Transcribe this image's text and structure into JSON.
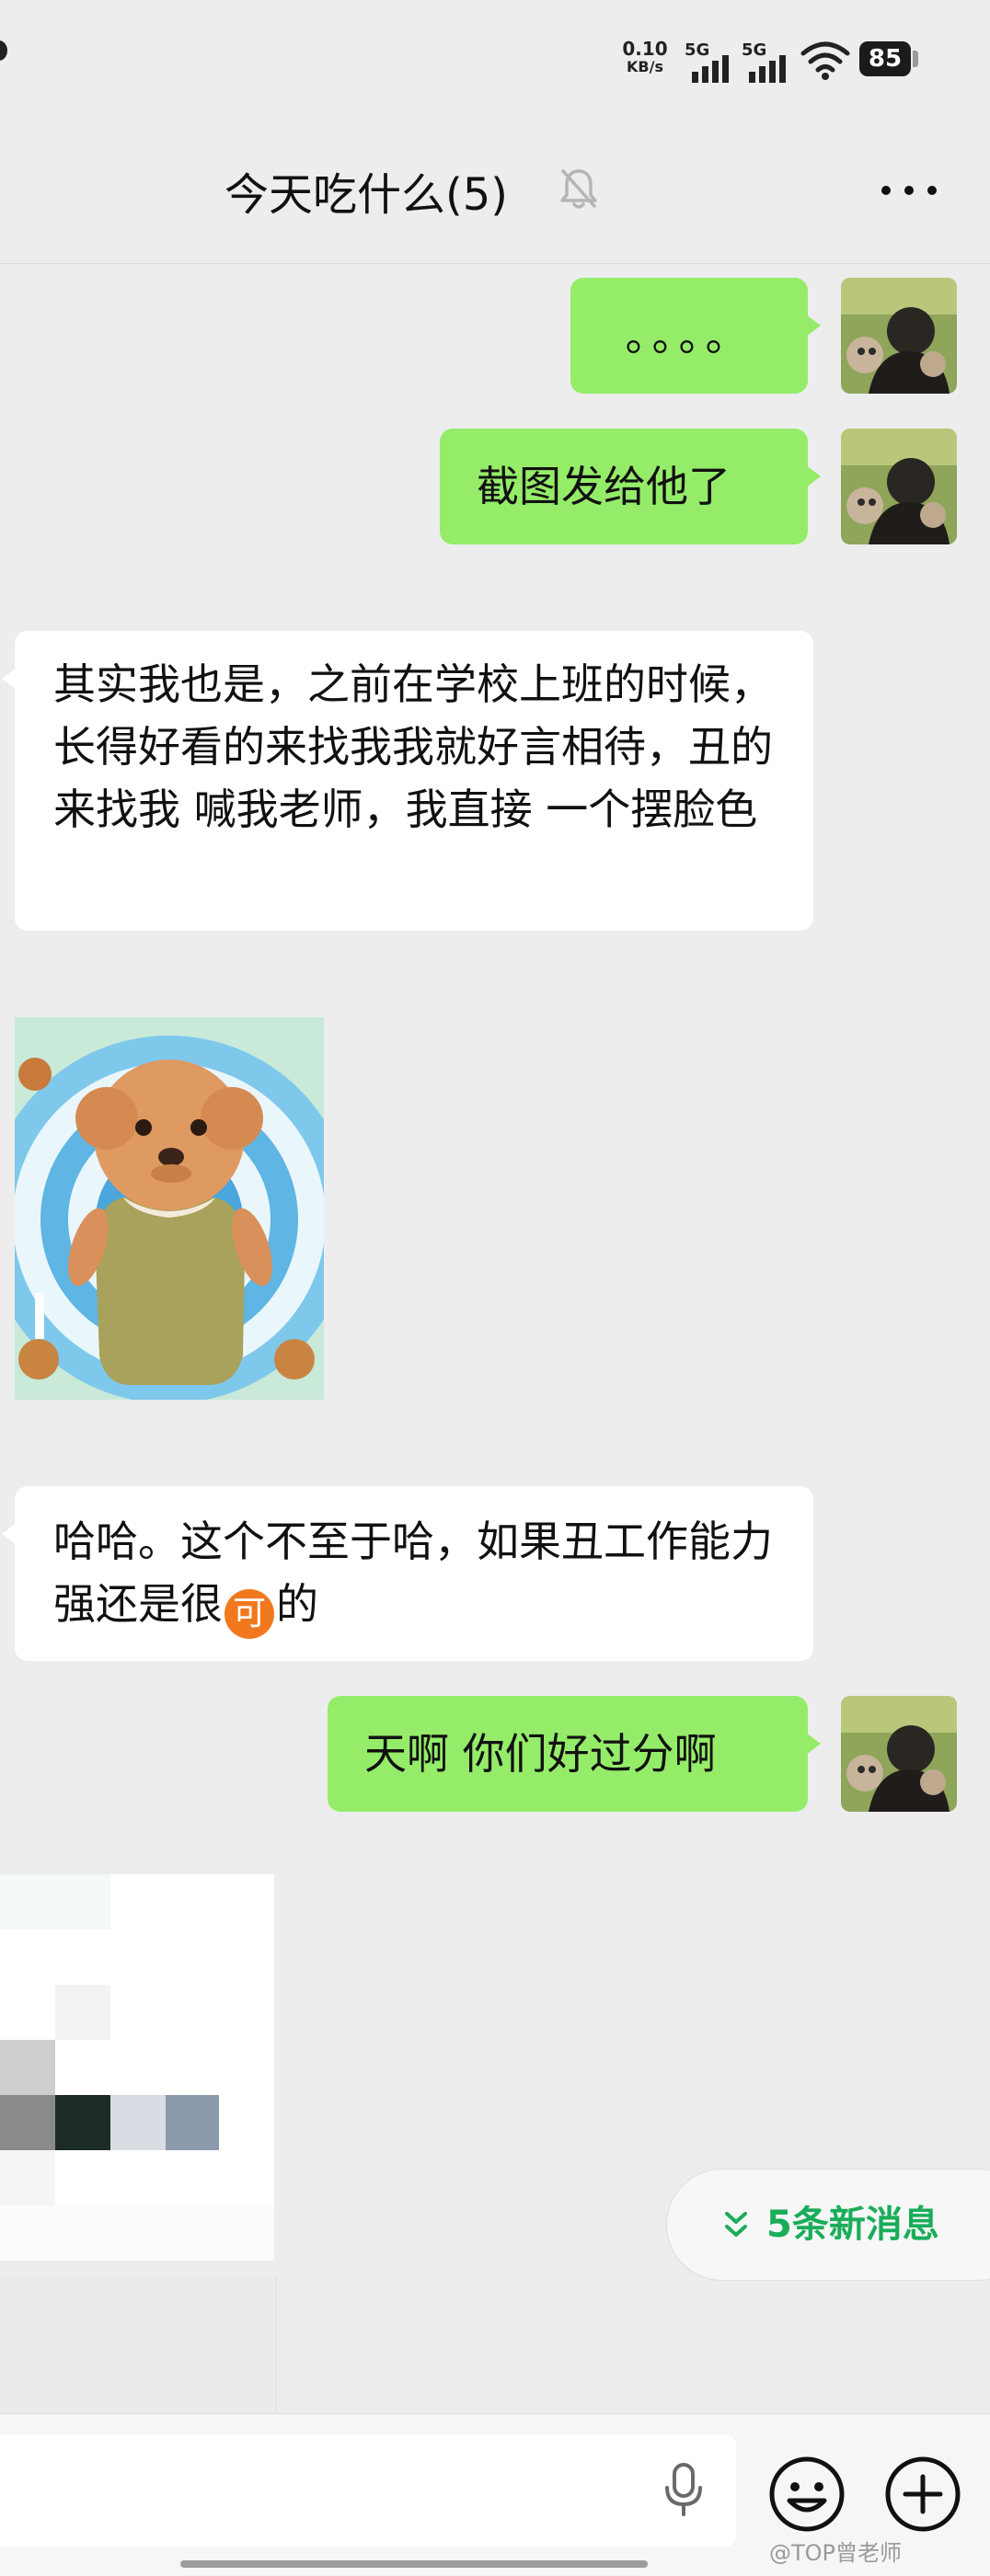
{
  "status_bar": {
    "net_speed_value": "0.10",
    "net_speed_unit": "KB/s",
    "signal_1_label": "5G",
    "signal_2_label": "5G",
    "battery_level": "85"
  },
  "header": {
    "title": "今天吃什么(5)",
    "muted_icon": "bell-off-icon",
    "more_icon": "more-dots-icon"
  },
  "messages": [
    {
      "side": "right",
      "text": "。。。。"
    },
    {
      "side": "right",
      "text": "截图发给他了"
    },
    {
      "side": "left",
      "text": "其实我也是，之前在学校上班的时候，长得好看的来找我我就好言相待，丑的来找我 喊我老师，我直接 一个摆脸色"
    },
    {
      "side": "left",
      "type": "sticker",
      "sticker": "toy-poodle-sticker"
    },
    {
      "side": "left",
      "text_before": "哈哈。这个不至于哈，如果丑工作能力强还是很",
      "emoji_char": "可",
      "text_after": "的"
    },
    {
      "side": "right",
      "text": "天啊 你们好过分啊"
    },
    {
      "side": "left",
      "type": "image",
      "note": "pixelated image"
    }
  ],
  "new_messages_pill": {
    "label": "5条新消息",
    "icon": "double-chevron-down-icon"
  },
  "input_bar": {
    "value": "",
    "mic_icon": "microphone-icon",
    "emoji_icon": "emoji-icon",
    "plus_icon": "plus-icon"
  },
  "watermark": "@TOP曾老师",
  "colors": {
    "background": "#ededed",
    "bubble_green": "#95ec69",
    "bubble_white": "#ffffff",
    "accent_green": "#1aad5a",
    "emoji_orange": "#f2781e"
  }
}
